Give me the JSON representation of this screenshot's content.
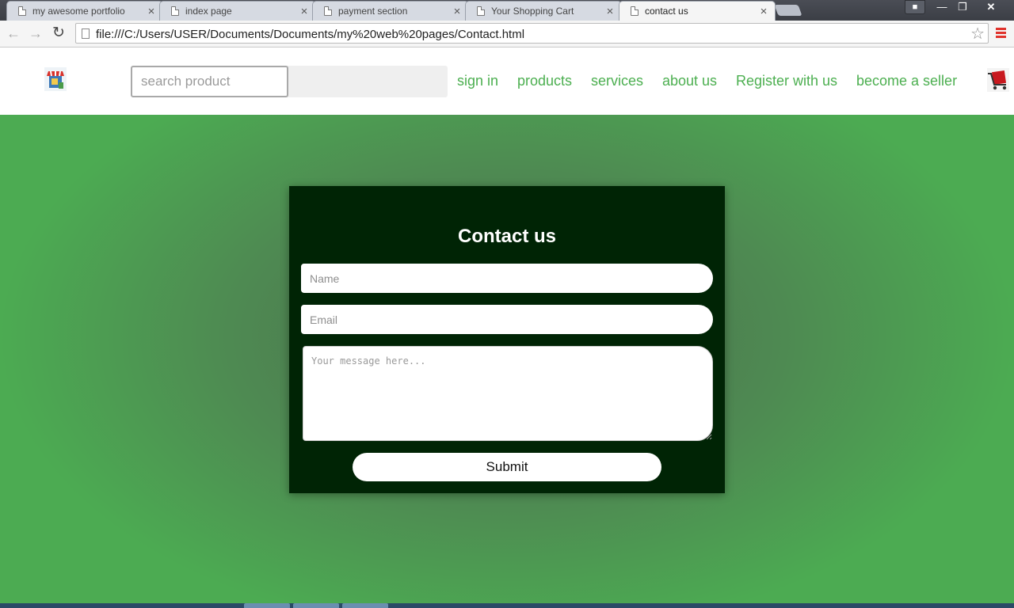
{
  "browser": {
    "tabs": [
      {
        "title": "my awesome portfolio",
        "active": false
      },
      {
        "title": "index page",
        "active": false
      },
      {
        "title": "payment section",
        "active": false
      },
      {
        "title": "Your Shopping Cart",
        "active": false
      },
      {
        "title": "contact us",
        "active": true
      }
    ],
    "tab_close_glyph": "×",
    "url": "file:///C:/Users/USER/Documents/Documents/my%20web%20pages/Contact.html",
    "icons": {
      "back": "arrow-left-icon",
      "forward": "arrow-right-icon",
      "reload": "reload-icon",
      "star": "bookmark-star-icon",
      "menu": "hamburger-menu-icon"
    }
  },
  "header": {
    "logo_icon": "shop-store-icon",
    "search_placeholder": "search product",
    "nav": [
      {
        "label": "sign in"
      },
      {
        "label": "products"
      },
      {
        "label": "services"
      },
      {
        "label": "about us"
      },
      {
        "label": "Register with us"
      },
      {
        "label": "become a seller"
      }
    ],
    "cart_icon": "shopping-cart-icon",
    "link_color": "#4caf50"
  },
  "contact": {
    "title": "Contact us",
    "name_placeholder": "Name",
    "email_placeholder": "Email",
    "message_placeholder": "Your message here...",
    "submit_label": "Submit",
    "card_color": "#002405",
    "background_color": "#4e8a52"
  }
}
